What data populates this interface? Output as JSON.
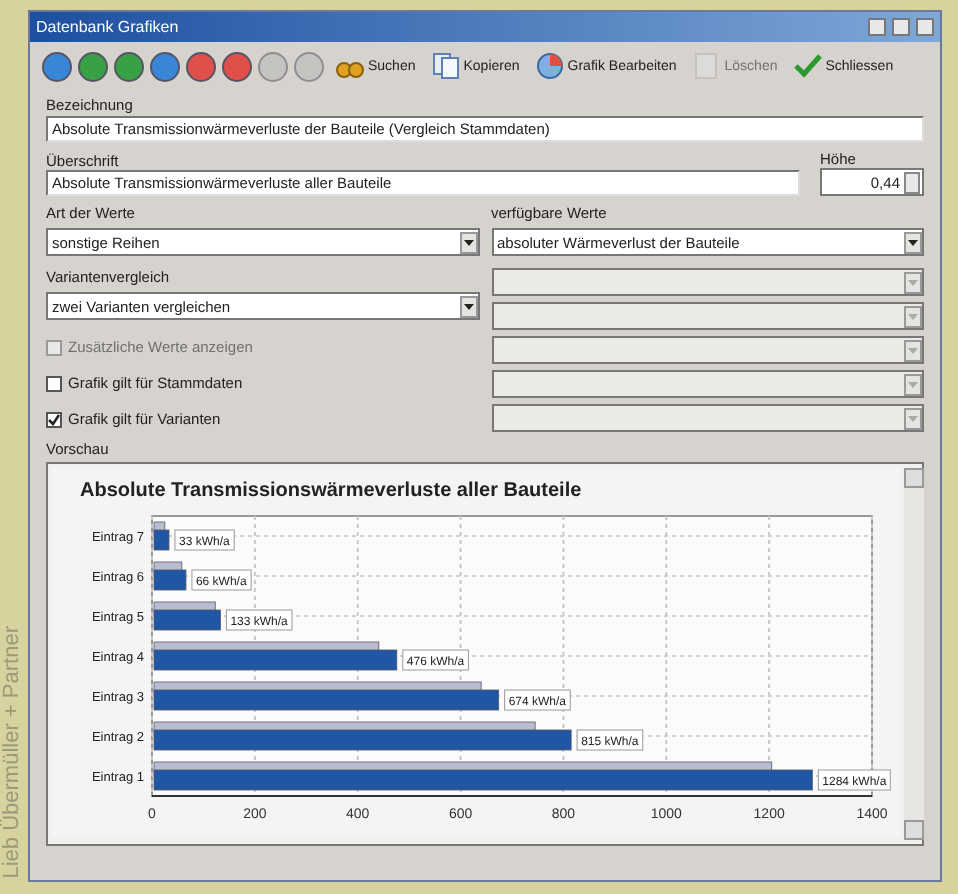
{
  "credit": "Lieb Übermüller + Partner",
  "window": {
    "title": "Datenbank Grafiken"
  },
  "toolbar": {
    "nav_buttons": [
      {
        "color": "#3a86d6",
        "disabled": false
      },
      {
        "color": "#3aa046",
        "disabled": false
      },
      {
        "color": "#3aa046",
        "disabled": false
      },
      {
        "color": "#3a86d6",
        "disabled": false
      },
      {
        "color": "#e0504a",
        "disabled": false
      },
      {
        "color": "#e0504a",
        "disabled": false
      },
      {
        "color": "#b8b8b8",
        "disabled": true
      },
      {
        "color": "#b8b8b8",
        "disabled": true
      }
    ],
    "actions": [
      {
        "kind": "search",
        "label": "Suchen",
        "disabled": false
      },
      {
        "kind": "copy",
        "label": "Kopieren",
        "disabled": false
      },
      {
        "kind": "edit",
        "label": "Grafik Bearbeiten",
        "disabled": false
      },
      {
        "kind": "delete",
        "label": "Löschen",
        "disabled": true
      },
      {
        "kind": "close",
        "label": "Schliessen",
        "disabled": false
      }
    ]
  },
  "bezeichnung": {
    "label": "Bezeichnung",
    "value": "Absolute Transmissionwärmeverluste der Bauteile (Vergleich Stammdaten)"
  },
  "ueberschrift": {
    "label": "Überschrift",
    "value": "Absolute Transmissionwärmeverluste aller Bauteile"
  },
  "hoehe": {
    "label": "Höhe",
    "value": "0,44"
  },
  "art_der_werte": {
    "label": "Art der Werte",
    "value": "sonstige Reihen"
  },
  "variantenvergleich": {
    "label": "Variantenvergleich",
    "value": "zwei Varianten vergleichen"
  },
  "verfuegbare_werte": {
    "label": "verfügbare Werte",
    "dropdowns": [
      {
        "value": "absoluter Wärmeverlust der Bauteile",
        "disabled": false
      },
      {
        "disabled": true
      },
      {
        "disabled": true
      },
      {
        "disabled": true
      },
      {
        "disabled": true
      },
      {
        "disabled": true
      }
    ]
  },
  "checkboxes": [
    {
      "label": "Zusätzliche Werte anzeigen",
      "checked": false,
      "disabled": true
    },
    {
      "label": "Grafik gilt für Stammdaten",
      "checked": false,
      "disabled": false
    },
    {
      "label": "Grafik gilt für Varianten",
      "checked": true,
      "disabled": false
    }
  ],
  "preview": {
    "label": "Vorschau",
    "chart_data": {
      "type": "bar",
      "orientation": "horizontal",
      "title": "Absolute Transmissionswärmeverluste aller Bauteile",
      "categories": [
        "Eintrag 7",
        "Eintrag 6",
        "Eintrag 5",
        "Eintrag 4",
        "Eintrag 3",
        "Eintrag 2",
        "Eintrag 1"
      ],
      "series": [
        {
          "color": "#b9bdd0",
          "values": [
            25,
            58,
            123,
            441,
            640,
            745,
            1205
          ]
        },
        {
          "color": "#1f57a4",
          "values": [
            33,
            66,
            133,
            476,
            674,
            815,
            1284
          ]
        }
      ],
      "value_labels": [
        "33 kWh/a",
        "66 kWh/a",
        "133 kWh/a",
        "476 kWh/a",
        "674 kWh/a",
        "815 kWh/a",
        "1284 kWh/a"
      ],
      "grid": true,
      "xlim": [
        0,
        1400
      ],
      "xticks": [
        0,
        200,
        400,
        600,
        800,
        1000,
        1200,
        1400
      ]
    }
  }
}
